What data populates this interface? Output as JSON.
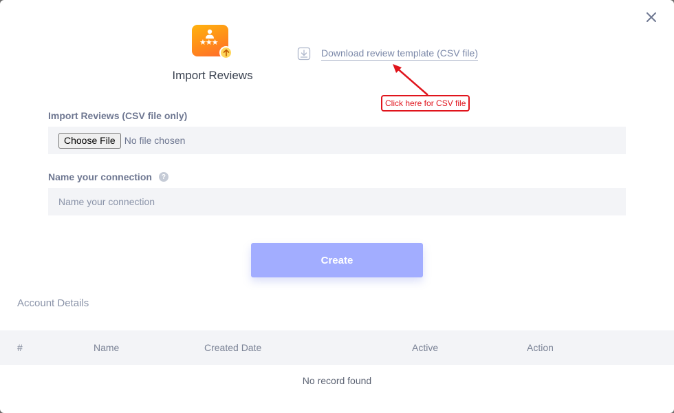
{
  "header": {
    "title": "Import Reviews",
    "download_link": "Download review template (CSV file)"
  },
  "annotation": {
    "text": "Click here for CSV file",
    "color": "#e0141c"
  },
  "form": {
    "csv_label": "Import Reviews (CSV file only)",
    "choose_file_label": "Choose File",
    "file_status": "No file chosen",
    "connection_label": "Name your connection",
    "connection_placeholder": "Name your connection",
    "connection_value": ""
  },
  "actions": {
    "create_label": "Create"
  },
  "account": {
    "title": "Account Details",
    "columns": [
      "#",
      "Name",
      "Created Date",
      "Active",
      "Action"
    ],
    "rows": [],
    "empty_message": "No record found"
  },
  "colors": {
    "accent": "#a2adff",
    "icon_gradient_start": "#ffb30f",
    "icon_gradient_end": "#ff6a2d"
  },
  "icons": {
    "close": "close-icon",
    "app": "import-reviews-icon",
    "download": "download-icon",
    "help": "help-icon"
  }
}
